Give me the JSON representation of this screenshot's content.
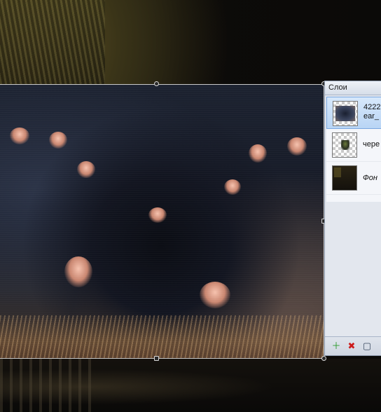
{
  "layers_panel": {
    "title": "Слои",
    "layers": [
      {
        "line1": "4222",
        "line2": "ear_",
        "selected": true
      },
      {
        "line1": "черe",
        "selected": false
      },
      {
        "line1": "Фон",
        "italic": true,
        "selected": false
      }
    ],
    "tools": [
      {
        "icon": "new-layer-icon",
        "glyph": "＋"
      },
      {
        "icon": "delete-layer-icon",
        "glyph": "✖"
      },
      {
        "icon": "duplicate-layer-icon",
        "glyph": "▢"
      }
    ]
  },
  "colors": {
    "panel_bg": "#e3e7ee",
    "selection": "#b9d5f5",
    "delete_red": "#cc1a1a",
    "new_green": "#2a9a2a"
  }
}
